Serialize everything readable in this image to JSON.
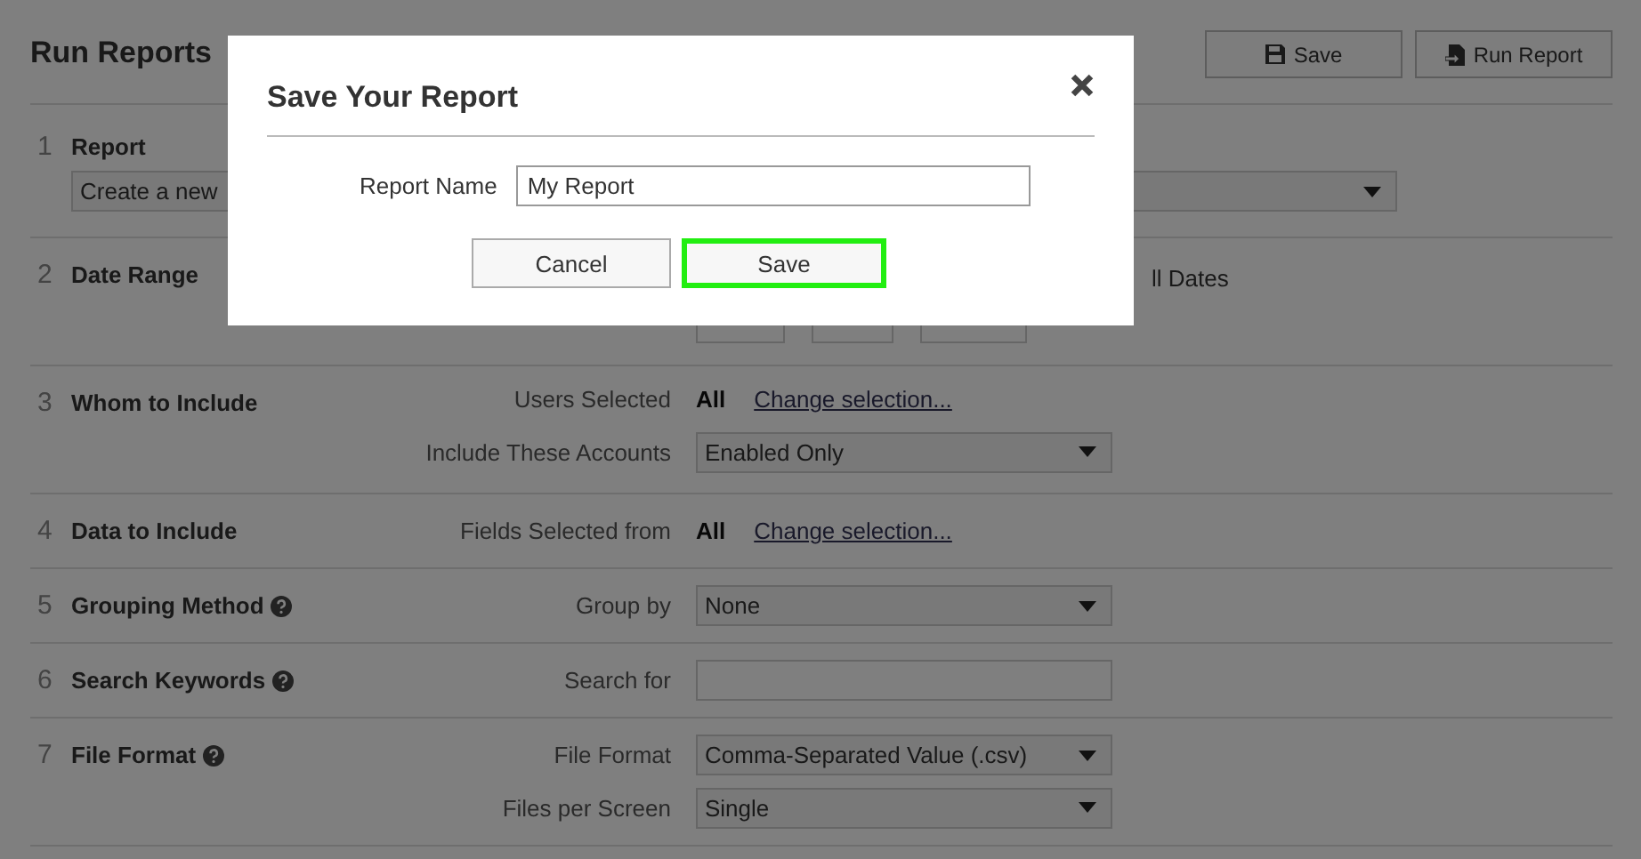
{
  "page": {
    "title": "Run Reports",
    "buttons": [
      {
        "label": "Save",
        "kind": "save"
      },
      {
        "label": "Run Report",
        "kind": "run"
      }
    ]
  },
  "sections": [
    {
      "number": "1",
      "title": "Report",
      "fields": [
        {
          "kind": "wide-select",
          "value": "Create a new"
        }
      ]
    },
    {
      "number": "2",
      "title": "Date Range",
      "fields": [
        {
          "kind": "dates",
          "text": "ll Dates"
        }
      ]
    },
    {
      "number": "3",
      "title": "Whom to Include",
      "fields": [
        {
          "kind": "selection",
          "label": "Users Selected",
          "value": "All",
          "link": "Change selection..."
        },
        {
          "kind": "select",
          "label": "Include These Accounts",
          "value": "Enabled Only"
        }
      ]
    },
    {
      "number": "4",
      "title": "Data to Include",
      "fields": [
        {
          "kind": "selection",
          "label": "Fields Selected from",
          "value": "All",
          "link": "Change selection..."
        }
      ]
    },
    {
      "number": "5",
      "title": "Grouping Method",
      "help": true,
      "fields": [
        {
          "kind": "select",
          "label": "Group by",
          "value": "None"
        }
      ]
    },
    {
      "number": "6",
      "title": "Search Keywords",
      "help": true,
      "fields": [
        {
          "kind": "text",
          "label": "Search for"
        }
      ]
    },
    {
      "number": "7",
      "title": "File Format",
      "help": true,
      "fields": [
        {
          "kind": "select",
          "label": "File Format",
          "value": "Comma-Separated Value (.csv)"
        },
        {
          "kind": "select",
          "label": "Files per Screen",
          "value": "Single"
        }
      ]
    }
  ],
  "dialog": {
    "title": "Save Your Report",
    "fields": [
      {
        "label": "Report Name",
        "value": "My Report"
      }
    ],
    "buttons": [
      {
        "label": "Cancel",
        "highlighted": false
      },
      {
        "label": "Save",
        "highlighted": true
      }
    ]
  }
}
